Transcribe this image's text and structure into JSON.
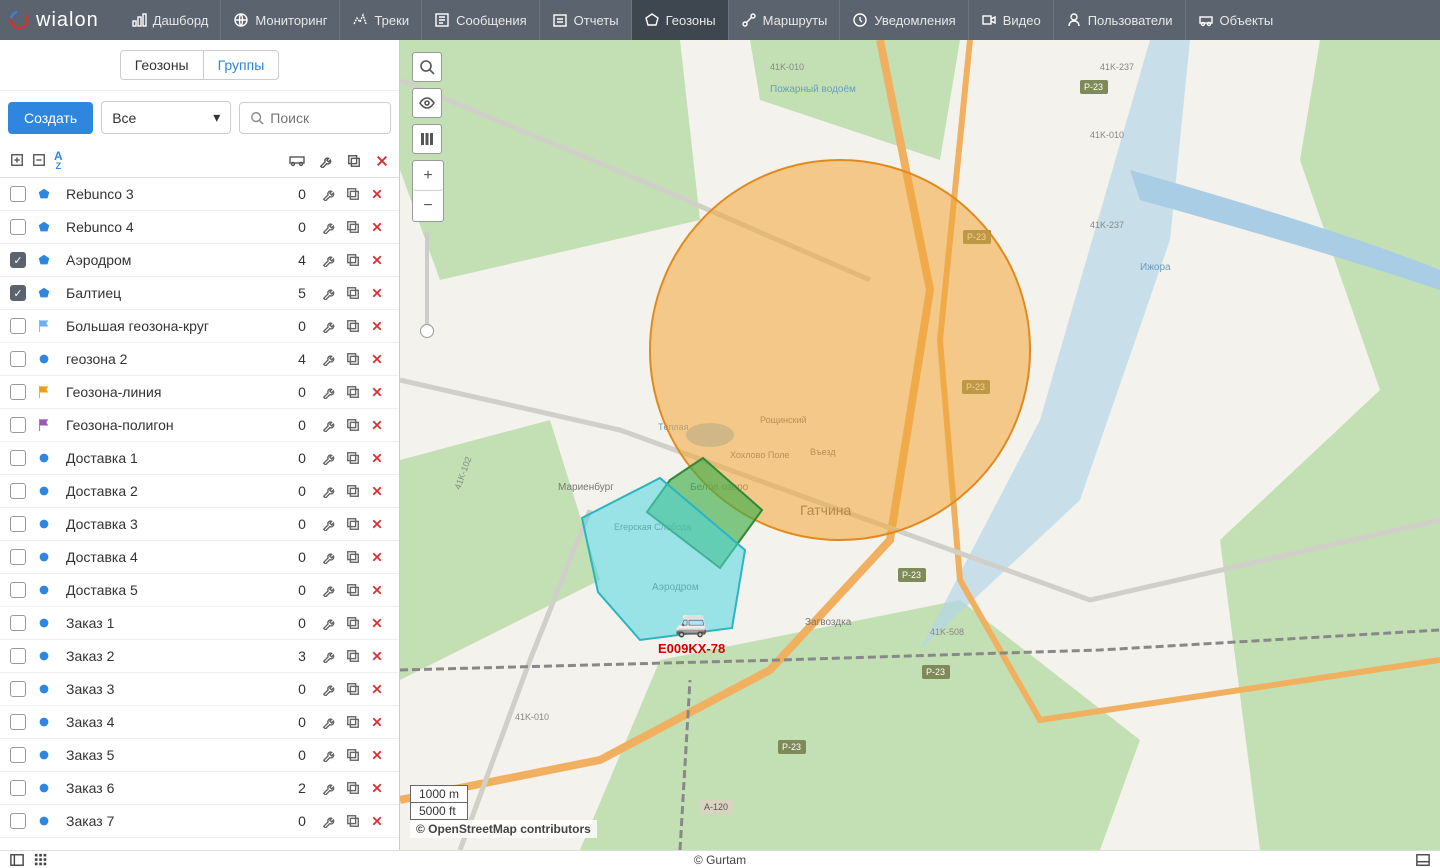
{
  "brand": "wialon",
  "nav": {
    "dashboard": "Дашборд",
    "monitoring": "Мониторинг",
    "tracks": "Треки",
    "messages": "Сообщения",
    "reports": "Отчеты",
    "geofences": "Геозоны",
    "routes": "Маршруты",
    "notifications": "Уведомления",
    "video": "Видео",
    "users": "Пользователи",
    "units": "Объекты"
  },
  "tabs": {
    "geofences": "Геозоны",
    "groups": "Группы"
  },
  "controls": {
    "create": "Создать",
    "filter_all": "Все",
    "search_placeholder": "Поиск"
  },
  "geofences": [
    {
      "name": "Rebunco 3",
      "count": 0,
      "checked": false,
      "icon": "poly",
      "color": "#2e86de"
    },
    {
      "name": "Rebunco 4",
      "count": 0,
      "checked": false,
      "icon": "poly",
      "color": "#2e86de"
    },
    {
      "name": "Аэродром",
      "count": 4,
      "checked": true,
      "icon": "poly",
      "color": "#2e86de"
    },
    {
      "name": "Балтиец",
      "count": 5,
      "checked": true,
      "icon": "poly",
      "color": "#2e86de"
    },
    {
      "name": "Большая геозона-круг",
      "count": 0,
      "checked": false,
      "icon": "flag",
      "color": "#6ab0f3"
    },
    {
      "name": "геозона 2",
      "count": 4,
      "checked": false,
      "icon": "circle",
      "color": "#2e86de"
    },
    {
      "name": "Геозона-линия",
      "count": 0,
      "checked": false,
      "icon": "flag",
      "color": "#f39c12"
    },
    {
      "name": "Геозона-полигон",
      "count": 0,
      "checked": false,
      "icon": "flag",
      "color": "#9b59b6"
    },
    {
      "name": "Доставка 1",
      "count": 0,
      "checked": false,
      "icon": "circle",
      "color": "#2e86de"
    },
    {
      "name": "Доставка 2",
      "count": 0,
      "checked": false,
      "icon": "circle",
      "color": "#2e86de"
    },
    {
      "name": "Доставка 3",
      "count": 0,
      "checked": false,
      "icon": "circle",
      "color": "#2e86de"
    },
    {
      "name": "Доставка 4",
      "count": 0,
      "checked": false,
      "icon": "circle",
      "color": "#2e86de"
    },
    {
      "name": "Доставка 5",
      "count": 0,
      "checked": false,
      "icon": "circle",
      "color": "#2e86de"
    },
    {
      "name": "Заказ 1",
      "count": 0,
      "checked": false,
      "icon": "circle",
      "color": "#2e86de"
    },
    {
      "name": "Заказ 2",
      "count": 3,
      "checked": false,
      "icon": "circle",
      "color": "#2e86de"
    },
    {
      "name": "Заказ 3",
      "count": 0,
      "checked": false,
      "icon": "circle",
      "color": "#2e86de"
    },
    {
      "name": "Заказ 4",
      "count": 0,
      "checked": false,
      "icon": "circle",
      "color": "#2e86de"
    },
    {
      "name": "Заказ 5",
      "count": 0,
      "checked": false,
      "icon": "circle",
      "color": "#2e86de"
    },
    {
      "name": "Заказ 6",
      "count": 2,
      "checked": false,
      "icon": "circle",
      "color": "#2e86de"
    },
    {
      "name": "Заказ 7",
      "count": 0,
      "checked": false,
      "icon": "circle",
      "color": "#2e86de"
    }
  ],
  "map": {
    "unit_label": "E009KX-78",
    "scale_m": "1000 m",
    "scale_ft": "5000 ft",
    "attribution": "© OpenStreetMap contributors",
    "labels": {
      "gatchina": "Гатчина",
      "aerodrom": "Аэродром",
      "zagvozdka": "Загвоздка",
      "beloe_ozero": "Белое озеро",
      "marienburg": "Мариенбург",
      "pozharny": "Пожарный водоём",
      "teplaya": "Тёплая",
      "izhora": "Ижора",
      "egerskaya": "Егерская Слобода",
      "roshchinskiy": "Рощинский",
      "hohlovo": "Хохлово Поле",
      "vezd": "Въезд"
    }
  },
  "footer": {
    "text": "© Gurtam"
  }
}
